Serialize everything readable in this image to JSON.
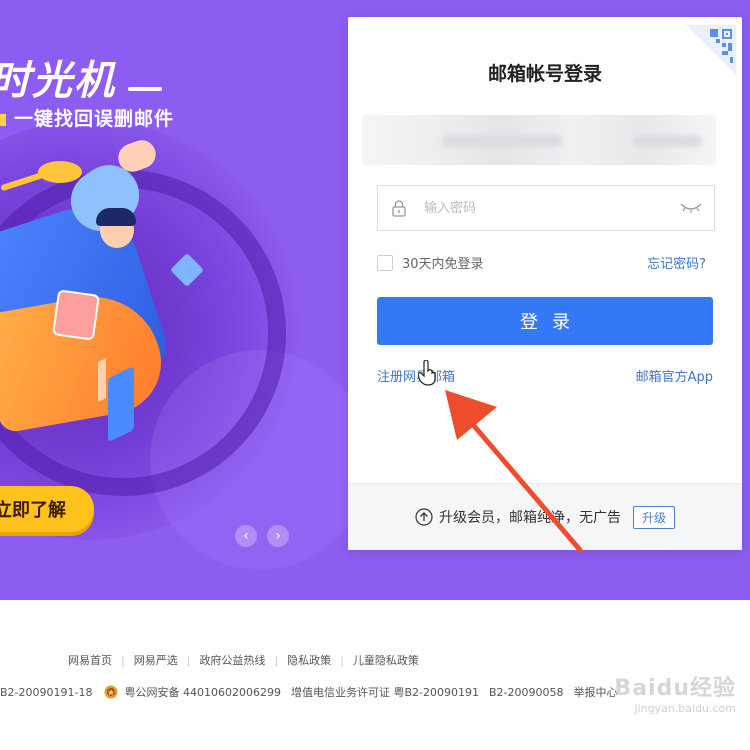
{
  "banner": {
    "title": "时光机",
    "subtitle": "一键找回误删邮件",
    "cta_label": "立即了解",
    "carousel_prev": "‹",
    "carousel_next": "›"
  },
  "login": {
    "title": "邮箱帐号登录",
    "password_placeholder": "输入密码",
    "remember_label": "30天内免登录",
    "forgot_label": "忘记密码?",
    "submit_label": "登录",
    "register_label": "注册网易邮箱",
    "app_label": "邮箱官方App",
    "upgrade_text": "升级会员，邮箱纯净，无广告",
    "upgrade_button": "升级"
  },
  "footer": {
    "links": [
      "网易首页",
      "网易严选",
      "政府公益热线",
      "隐私政策",
      "儿童隐私政策"
    ],
    "license1": "B2-20090191-18",
    "police": "粤公网安备 44010602006299",
    "license2": "增值电信业务许可证 粤B2-20090191",
    "license3": "B2-20090058",
    "report": "举报中心"
  },
  "watermark": {
    "logo": "Baidu经验",
    "url": "jingyan.baidu.com"
  },
  "colors": {
    "banner": "#8d5cf0",
    "primary_button": "#3478f6",
    "link": "#3e76c9",
    "cta": "#ffc21a",
    "annotation_arrow": "#ee4d2d"
  }
}
